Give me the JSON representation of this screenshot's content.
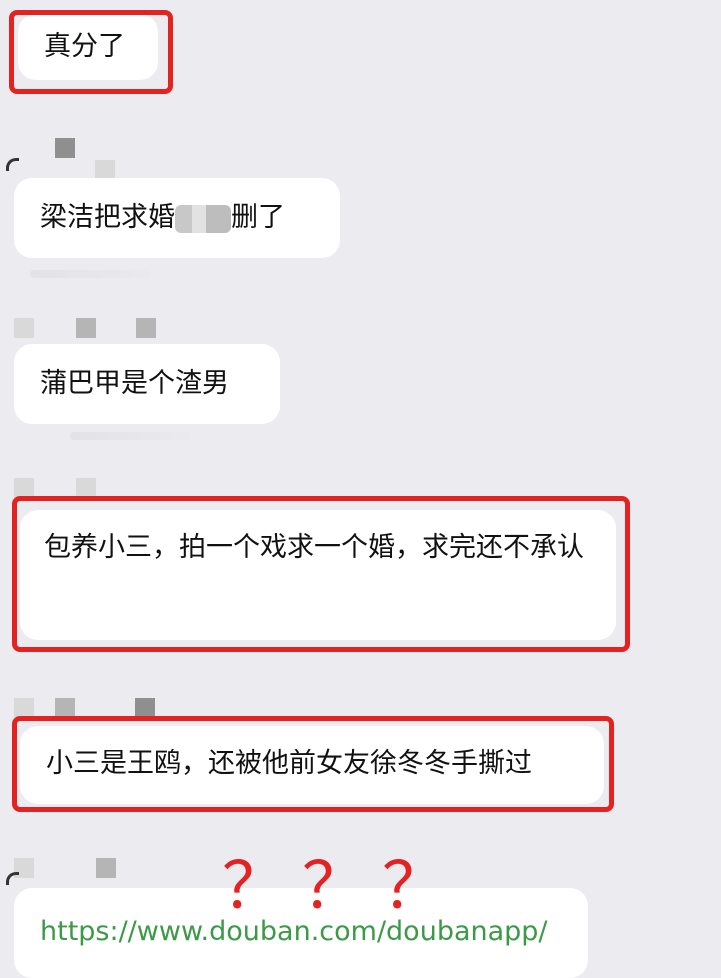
{
  "messages": [
    {
      "text": "真分了"
    },
    {
      "text_before": "梁洁把求婚",
      "text_after": "删了"
    },
    {
      "text": "蒲巴甲是个渣男"
    },
    {
      "text": "包养小三，拍一个戏求一个婚，求完还不承认"
    },
    {
      "text": "小三是王鸥，还被他前女友徐冬冬手撕过"
    },
    {
      "text": "https://www.douban.com/doubanapp/"
    }
  ],
  "annotations": {
    "question_marks": [
      "？",
      "？",
      "？"
    ],
    "highlight_color": "#e52222"
  },
  "colors": {
    "background": "#ececf0",
    "bubble": "#ffffff",
    "link": "#3c9a47",
    "highlight": "#e52222"
  }
}
